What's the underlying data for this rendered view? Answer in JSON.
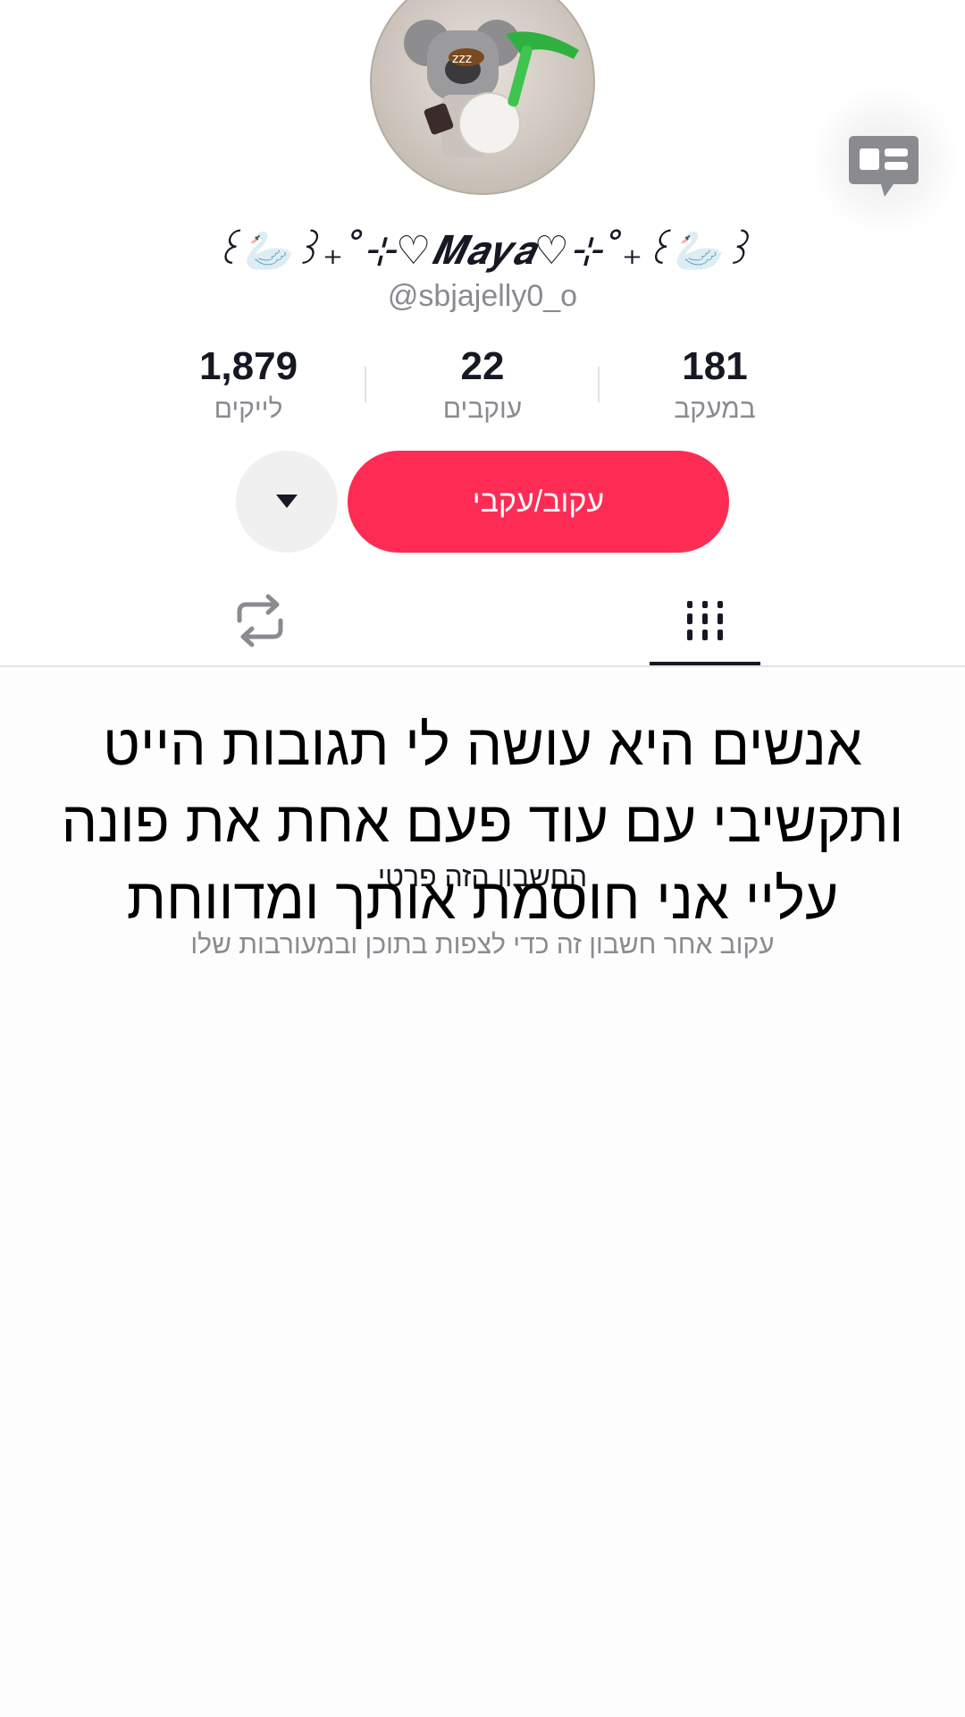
{
  "profile": {
    "display_name": "꒰🦢꒱₊˚⊹♡𝑴𝒂𝒚𝒂♡⊹˚₊꒰🦢꒱",
    "username": "@sbjajelly0_o"
  },
  "stats": {
    "likes": {
      "value": "1,879",
      "label": "לייקים"
    },
    "followers": {
      "value": "22",
      "label": "עוקבים"
    },
    "following": {
      "value": "181",
      "label": "במעקב"
    }
  },
  "actions": {
    "follow_label": "עקוב/עקבי"
  },
  "private": {
    "title": "החשבון הזה פרטי",
    "subtitle": "עקוב אחר חשבון זה כדי לצפות בתוכן ובמעורבות שלו"
  },
  "overlay": {
    "text": "אנשים היא עושה לי תגובות הייט ותקשיבי עם עוד פעם אחת את פונה עליי אני חוסמת אותך ומדווחת"
  },
  "colors": {
    "accent": "#fe2c55",
    "text_primary": "#161823",
    "text_secondary": "#8a8b91"
  },
  "icons": {
    "inbox": "message-bubble-icon",
    "repost": "repost-icon",
    "videos": "video-grid-icon",
    "more": "caret-down-icon"
  }
}
